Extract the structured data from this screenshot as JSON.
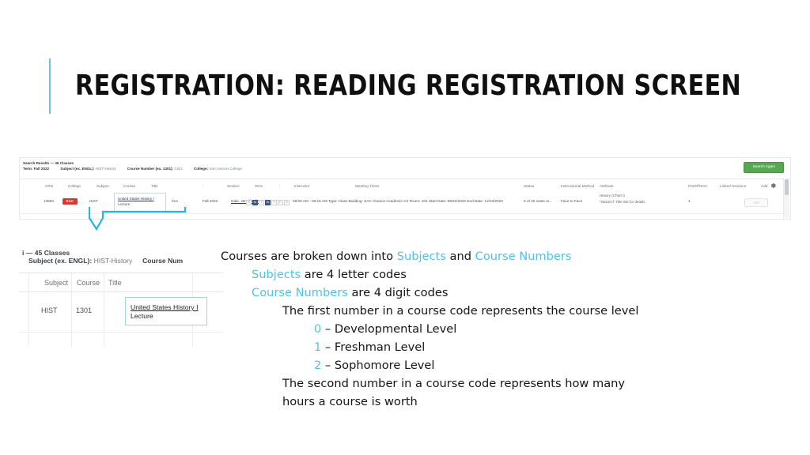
{
  "slide": {
    "title": "REGISTRATION: READING REGISTRATION SCREEN",
    "accent_color": "#6CC3DB",
    "body_blue": "#4EC3E8"
  },
  "screenshot": {
    "summary": {
      "line1_label": "Search Results",
      "line1_count": "— 45 Classes",
      "term_label": "Term:",
      "term_value": "Fall 2022",
      "subject_label": "Subject (ex. ENGL):",
      "subject_value": "HIST-History",
      "course_number_label": "Course Number (ex. 1301):",
      "course_number_value": "1301",
      "college_label": "College:",
      "college_value": "San Antonio College"
    },
    "search_again_label": "Search Again",
    "search_again_color": "#58a752",
    "columns": [
      "CRN",
      "College",
      "Subject",
      "Course",
      "Title",
      "Section",
      "Term",
      "Instructor",
      "Meeting Times",
      "Status",
      "Instructional Method",
      "Attribute",
      "PartOfTerm",
      "Linked Sections",
      "Add"
    ],
    "gear_icon": "gear-icon",
    "row": {
      "crn": "13553",
      "college": "SAC",
      "college_badge_color": "#d9382c",
      "subject": "HIST",
      "course": "1301",
      "title_line1": "United States History I",
      "title_line2": "Lecture",
      "section": "014",
      "term": "Fall 2022",
      "instructor": "Cain, Jennifer (P ...",
      "meeting_days": [
        {
          "letter": "S",
          "on": false
        },
        {
          "letter": "M",
          "on": true
        },
        {
          "letter": "T",
          "on": false
        },
        {
          "letter": "W",
          "on": true
        },
        {
          "letter": "T",
          "on": false
        },
        {
          "letter": "F",
          "on": false
        },
        {
          "letter": "S",
          "on": false
        }
      ],
      "meeting_times": "08:00 AM - 09:15 AM  Type: Class  Building: SAC Chance Academic Ctr  Room: 104  Start Date: 08/22/2022  End Date: 12/10/2022",
      "status": "3 of 20 seats re...",
      "instructional_method": "Face to Face",
      "attribute_line1": "History (Chart I)",
      "attribute_line2": "*SELECT Title link for details",
      "part_of_term": "1",
      "add_label": "Add"
    }
  },
  "magnified": {
    "summary_line1": "i — 45 Classes",
    "summary_line2_label": "Subject (ex. ENGL):",
    "summary_line2_value": "HIST-History",
    "summary_line2_label2": "Course Num",
    "columns": [
      "Subject",
      "Course",
      "Title"
    ],
    "sort_icon": "sort-icon",
    "row": {
      "subject": "HIST",
      "course": "1301",
      "title_line1": "United States History I",
      "title_line2": "Lecture"
    },
    "highlight_color": "#9fd9cf"
  },
  "body": {
    "l1_a": "Courses are broken down into ",
    "l1_subjects": "Subjects",
    "l1_b": " and ",
    "l1_course_numbers": "Course Numbers",
    "l2a_blue": "Subjects",
    "l2a_rest": " are 4 letter codes",
    "l2b_blue": "Course Numbers",
    "l2b_rest": " are 4 digit codes",
    "l3": "The first number in a course code represents the course level",
    "l4_0_num": "0",
    "l4_0_rest": " – Developmental Level",
    "l4_1_num": "1",
    "l4_1_rest": " – Freshman Level",
    "l4_2_num": "2",
    "l4_2_rest": " – Sophomore Level",
    "l3_second": "The second number in a course code represents how many hours a course is worth"
  }
}
